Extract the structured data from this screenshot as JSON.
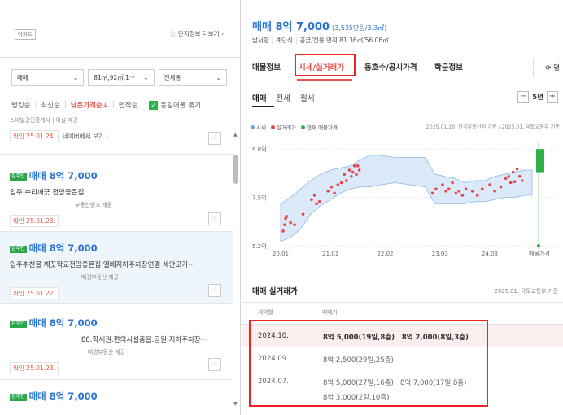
{
  "left": {
    "apt_tag": "아파트",
    "complex_info_link": "단지정보 더보기",
    "filters": {
      "trade_type": "매매",
      "area": "81㎡,92㎡,1···",
      "dong": "전체동"
    },
    "sort": {
      "options": [
        "랭킹순",
        "최신순",
        "낮은가격순↓",
        "면적순"
      ],
      "active_index": 2,
      "same_listing_label": "동일매물 묶기"
    },
    "listings": [
      {
        "price": "",
        "description": "",
        "agent": "스마일공인중개사 | 아실 제공",
        "confirm": "확인 25.01.24.",
        "extra_link": "네이버에서 보기"
      },
      {
        "tag": "집주인",
        "price": "매매 8억 7,000",
        "description": "입주 수리깨끗 전망좋은집",
        "agent": "부동산뱅크 제공",
        "confirm": "확인 25.01.23."
      },
      {
        "tag": "집주인",
        "price": "매매 8억 7,000",
        "description": "입주추천물 깨끗학교전망좋은집 엘베지하주차장연결 세안고가···",
        "agent": "매경부동산 제공",
        "confirm": "확인 25.01.22."
      },
      {
        "tag": "집주인",
        "price": "매매 8억 7,000",
        "description": "88.학세권.편의시설충을.공원.지하주차장···",
        "agent": "매경부동산 제공",
        "confirm": "확인 25.01.23."
      },
      {
        "tag": "집주인",
        "price": "매매 8억 7,000"
      }
    ]
  },
  "right": {
    "price_title": "매매 8억 7,000",
    "price_per_area": "(3,535만원/3.3㎡)",
    "orientation": "남서향",
    "structure": "계단식",
    "area_info": "공급/전용 면적 81.36㎡/56.06㎡",
    "tabs": [
      "매물정보",
      "시세/실거래가",
      "동호수/공시가격",
      "학군정보"
    ],
    "active_tab": 1,
    "pub_tab": "평",
    "subtabs": [
      "매매",
      "전세",
      "월세"
    ],
    "year_label": "5년",
    "legend": [
      "시세",
      "실거래가",
      "현재 매물가격"
    ],
    "legend_source": "2025.01.20. 한국부동산원 기준 / 2025.01. 국토교통부 기준",
    "section_title": "매매 실거래가",
    "section_source": "2025.01. 국토교통부 기준",
    "table_header": [
      "계약월",
      "매매가"
    ],
    "rows": [
      {
        "date": "2024.10.",
        "deal1": "8억 5,000(19일,8층)",
        "deal2": "8억 2,000(8일,3층)"
      },
      {
        "date": "2024.09.",
        "deal1": "8억 2,500(29일,25층)"
      },
      {
        "date": "2024.07.",
        "deal1": "8억 5,000(27일,16층)",
        "deal2": "8억 7,000(17일,8층)",
        "deal3": "8억 3,000(2일,10층)"
      }
    ]
  },
  "colors": {
    "accent_blue": "#2a74cf",
    "accent_red": "#e2534b",
    "green": "#2db24a",
    "band_fill": "#dbeaf9",
    "band_line": "#8fb8e4",
    "deal_dot": "#e6474e"
  },
  "chart_data": {
    "type": "scatter",
    "y_tick_labels": [
      "9.8억",
      "7.5억",
      "5.2억"
    ],
    "y_ticks": [
      9.8,
      7.5,
      5.2
    ],
    "ylim": [
      5.2,
      10.0
    ],
    "x_tick_labels": [
      "20.01",
      "21.01",
      "22.02",
      "23.03",
      "24.03",
      "매물가격"
    ],
    "xlim": [
      2020.0,
      2025.05
    ],
    "market_band": {
      "x": [
        2020.0,
        2020.2,
        2020.4,
        2020.6,
        2020.8,
        2021.0,
        2021.2,
        2021.4,
        2021.6,
        2021.8,
        2022.0,
        2022.3,
        2022.6,
        2022.9,
        2023.1,
        2023.3,
        2023.5,
        2023.7,
        2023.9,
        2024.1,
        2024.3,
        2024.5,
        2024.7,
        2024.9,
        2025.05
      ],
      "upper": [
        7.2,
        7.5,
        7.9,
        8.3,
        8.6,
        8.8,
        8.9,
        9.0,
        9.3,
        9.5,
        9.5,
        9.4,
        9.4,
        9.4,
        8.6,
        8.5,
        8.4,
        8.2,
        8.3,
        8.3,
        8.5,
        8.6,
        8.7,
        8.8,
        8.8
      ],
      "lower": [
        5.4,
        5.6,
        6.0,
        6.7,
        7.1,
        7.4,
        7.7,
        7.9,
        8.0,
        8.0,
        8.1,
        8.2,
        8.1,
        8.0,
        7.2,
        7.2,
        7.2,
        7.2,
        7.3,
        7.3,
        7.4,
        7.5,
        7.5,
        7.6,
        7.6
      ]
    },
    "deals": {
      "x": [
        2020.05,
        2020.08,
        2020.1,
        2020.12,
        2020.2,
        2020.28,
        2020.45,
        2020.62,
        2020.68,
        2020.72,
        2020.78,
        2020.95,
        2021.02,
        2021.08,
        2021.15,
        2021.22,
        2021.28,
        2021.32,
        2021.38,
        2021.42,
        2021.45,
        2021.48,
        2021.52,
        2021.55,
        2021.58,
        2023.05,
        2023.12,
        2023.25,
        2023.32,
        2023.38,
        2023.45,
        2023.52,
        2023.58,
        2023.65,
        2023.72,
        2023.85,
        2023.95,
        2024.05,
        2024.2,
        2024.3,
        2024.42,
        2024.52,
        2024.58,
        2024.62,
        2024.67,
        2024.7,
        2024.75,
        2024.8,
        2024.85
      ],
      "y": [
        5.9,
        6.2,
        6.5,
        6.6,
        6.3,
        6.2,
        6.7,
        7.4,
        7.6,
        7.2,
        7.3,
        7.8,
        8.0,
        7.7,
        8.1,
        8.2,
        8.6,
        8.3,
        8.8,
        8.5,
        8.7,
        9.0,
        8.6,
        9.0,
        8.8,
        7.7,
        7.9,
        8.1,
        7.8,
        7.9,
        8.2,
        7.7,
        7.8,
        7.6,
        7.9,
        7.8,
        7.6,
        7.9,
        8.1,
        7.8,
        8.0,
        8.4,
        8.5,
        8.2,
        8.7,
        8.25,
        8.85,
        8.5,
        8.3
      ]
    },
    "current_listing_range": [
      8.7,
      9.8
    ],
    "current_listing_marker": 5.2
  }
}
